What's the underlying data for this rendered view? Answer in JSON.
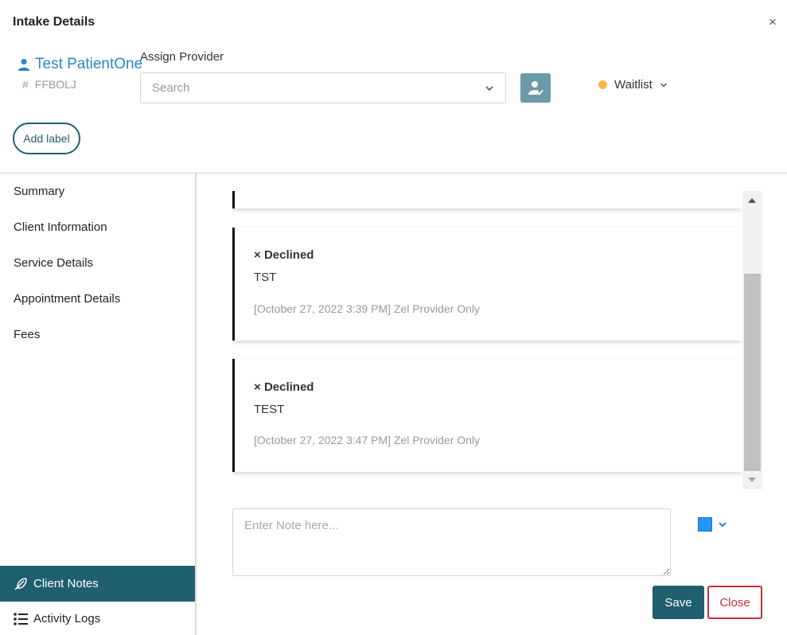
{
  "modal": {
    "title": "Intake Details",
    "close_glyph": "×"
  },
  "patient": {
    "name": "Test PatientOne",
    "id_prefix": "#",
    "id": "FFBOLJ",
    "icon": "person-icon"
  },
  "assign_provider": {
    "label": "Assign Provider",
    "placeholder": "Search",
    "button_icon": "assign-user-icon"
  },
  "status": {
    "label": "Waitlist",
    "dot_color": "#f5b942"
  },
  "add_label_button": "Add label",
  "sidebar": {
    "items": [
      {
        "label": "Summary"
      },
      {
        "label": "Client Information"
      },
      {
        "label": "Service Details"
      },
      {
        "label": "Appointment Details"
      },
      {
        "label": "Fees"
      }
    ],
    "bottom_items": [
      {
        "label": "Client Notes",
        "icon": "feather-pen-icon",
        "active": true
      },
      {
        "label": "Activity Logs",
        "icon": "list-icon",
        "active": false
      }
    ]
  },
  "notes": [
    {
      "status_glyph": "×",
      "status": "Declined",
      "text": "TST",
      "meta": "[October 27, 2022 3:39 PM] Zel Provider Only"
    },
    {
      "status_glyph": "×",
      "status": "Declined",
      "text": "TEST",
      "meta": "[October 27, 2022 3:47 PM] Zel Provider Only"
    }
  ],
  "note_input": {
    "placeholder": "Enter Note here..."
  },
  "note_color": {
    "value": "#2196f3"
  },
  "actions": {
    "save": "Save",
    "close": "Close"
  },
  "colors": {
    "primary": "#1f5f6e",
    "link": "#2b86c5",
    "danger": "#c8303d"
  }
}
